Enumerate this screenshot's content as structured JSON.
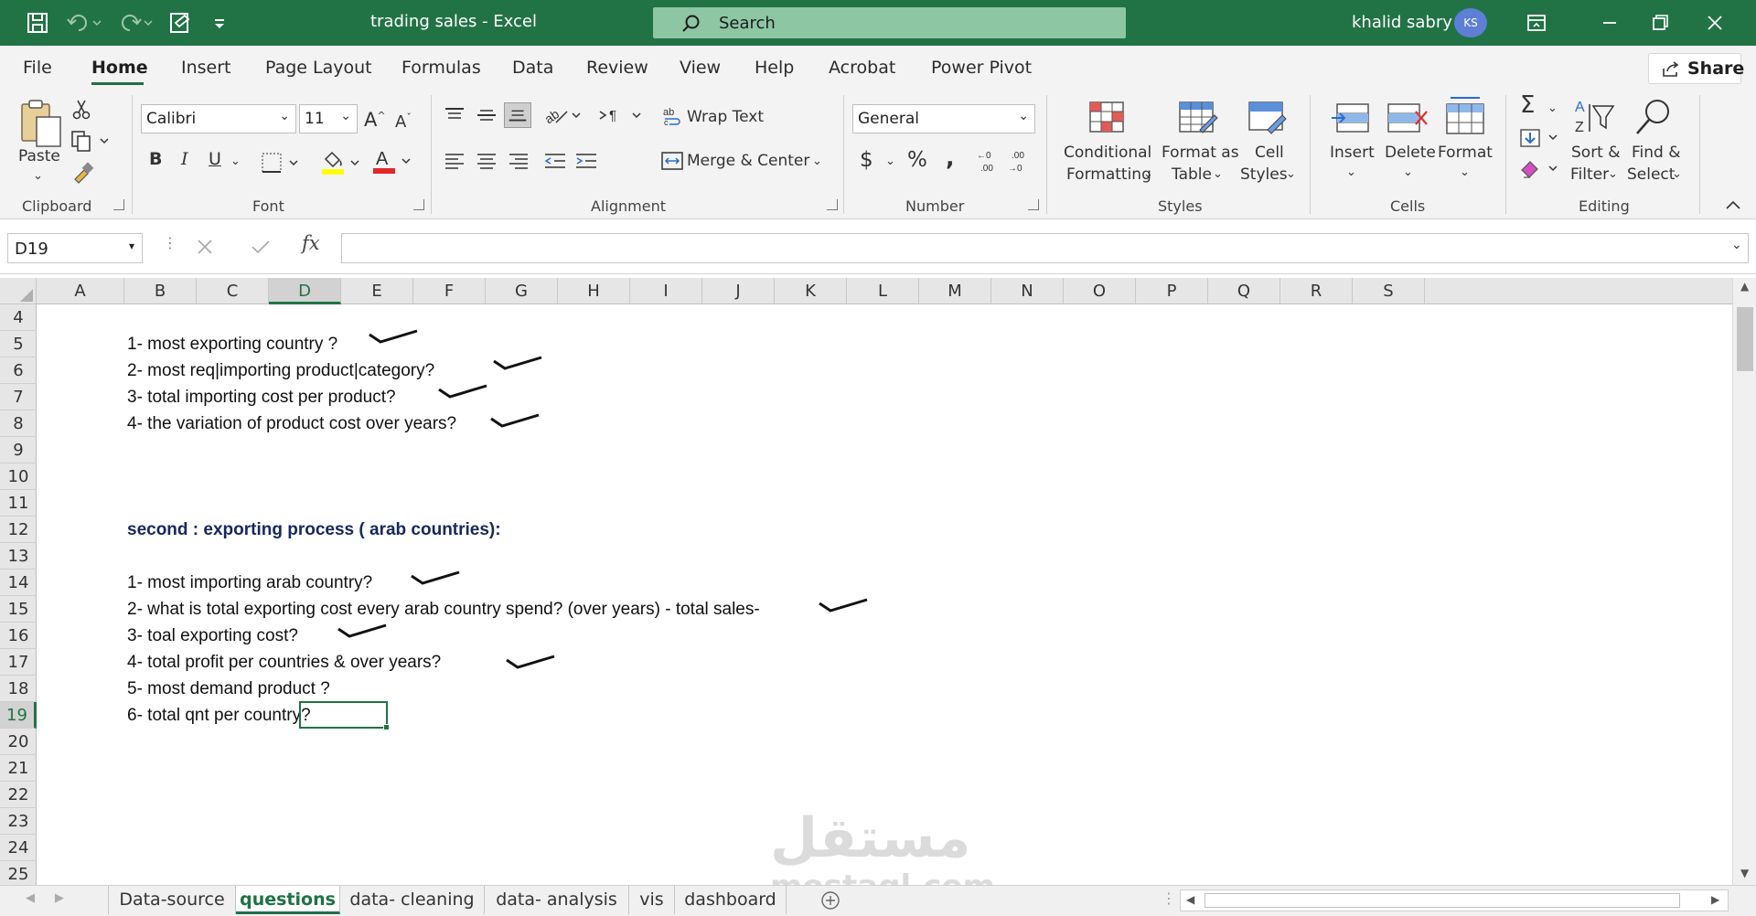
{
  "window": {
    "title": "trading sales  -  Excel",
    "search_placeholder": "Search",
    "user_name": "khalid sabry",
    "user_initials": "KS"
  },
  "menu": {
    "tabs": [
      "File",
      "Home",
      "Insert",
      "Page Layout",
      "Formulas",
      "Data",
      "Review",
      "View",
      "Help",
      "Acrobat",
      "Power Pivot"
    ],
    "active": "Home",
    "share_label": "Share"
  },
  "ribbon": {
    "clipboard": {
      "paste_label": "Paste",
      "group_label": "Clipboard"
    },
    "font": {
      "name": "Calibri",
      "size": "11",
      "group_label": "Font"
    },
    "alignment": {
      "wrap_text": "Wrap Text",
      "merge_center": "Merge & Center",
      "group_label": "Alignment"
    },
    "number": {
      "format": "General",
      "group_label": "Number"
    },
    "styles": {
      "conditional_formatting": [
        "Conditional",
        "Formatting"
      ],
      "format_as_table": [
        "Format as",
        "Table"
      ],
      "cell_styles": [
        "Cell",
        "Styles"
      ],
      "group_label": "Styles"
    },
    "cells": {
      "insert": "Insert",
      "delete": "Delete",
      "format": "Format",
      "group_label": "Cells"
    },
    "editing": {
      "sort_filter": [
        "Sort &",
        "Filter"
      ],
      "find_select": [
        "Find &",
        "Select"
      ],
      "group_label": "Editing"
    }
  },
  "formula_bar": {
    "name_box": "D19",
    "formula": ""
  },
  "grid": {
    "columns": [
      "A",
      "B",
      "C",
      "D",
      "E",
      "F",
      "G",
      "H",
      "I",
      "J",
      "K",
      "L",
      "M",
      "N",
      "O",
      "P",
      "Q",
      "R",
      "S"
    ],
    "selected_column": "D",
    "rows": [
      "4",
      "5",
      "6",
      "7",
      "8",
      "9",
      "10",
      "11",
      "12",
      "13",
      "14",
      "15",
      "16",
      "17",
      "18",
      "19",
      "20",
      "21",
      "22",
      "23",
      "24",
      "25"
    ],
    "selected_row": "19",
    "cells": {
      "b5": "1- most exporting country ?",
      "b6": "2- most req|importing product|category?",
      "b7": "3- total importing cost per product?",
      "b8": "4- the variation of product cost over years?",
      "b12": "second : exporting process ( arab countries):",
      "b14": "1- most importing arab country?",
      "b15": "2- what is total exporting cost every arab country spend? (over years) - total sales-",
      "b16": "3- toal exporting cost?",
      "b17": "4- total profit per countries & over years?",
      "b18": "5- most demand product ?",
      "b19": "6- total qnt per country?"
    }
  },
  "watermark": {
    "arabic": "مستقل",
    "latin": "mostaql.com"
  },
  "sheets": {
    "tabs": [
      "Data-source",
      "questions",
      "data- cleaning",
      "data- analysis",
      "vis",
      "dashboard"
    ],
    "active": "questions"
  },
  "colors": {
    "accent": "#217346",
    "heading_text": "#17285c"
  }
}
